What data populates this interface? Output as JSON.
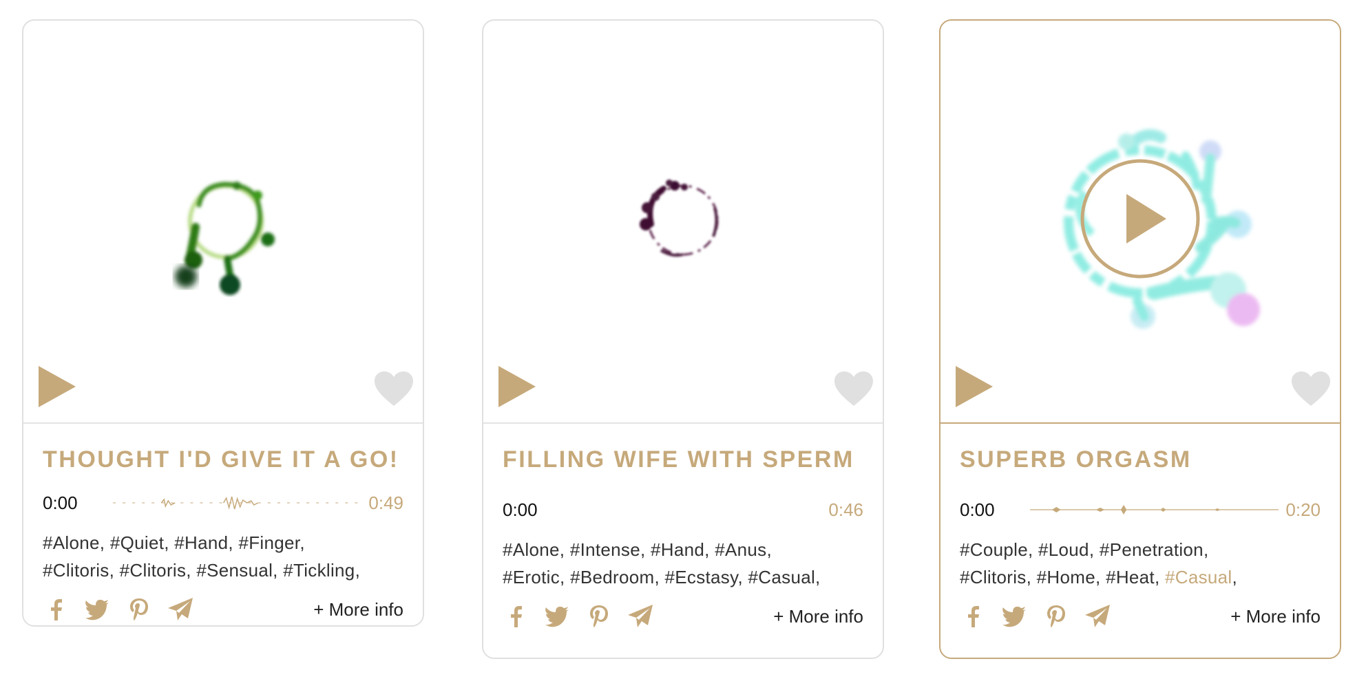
{
  "accent": "#c6a97b",
  "cards": [
    {
      "title": "THOUGHT I'D GIVE IT A GO!",
      "time_current": "0:00",
      "duration": "0:49",
      "tags": [
        "#Alone",
        "#Quiet",
        "#Hand",
        "#Finger",
        "#Clitoris",
        "#Clitoris",
        "#Sensual",
        "#Tickling"
      ],
      "highlighted_tag_index": -1,
      "visual_color": "#2f7d1c",
      "share_icons": [
        "facebook-icon",
        "twitter-icon",
        "pinterest-icon",
        "send-icon"
      ],
      "more_info": "+ More info"
    },
    {
      "title": "FILLING WIFE WITH SPERM",
      "time_current": "0:00",
      "duration": "0:46",
      "tags": [
        "#Alone",
        "#Intense",
        "#Hand",
        "#Anus",
        "#Erotic",
        "#Bedroom",
        "#Ecstasy",
        "#Casual"
      ],
      "highlighted_tag_index": -1,
      "visual_color": "#4a1a3c",
      "share_icons": [
        "facebook-icon",
        "twitter-icon",
        "pinterest-icon",
        "send-icon"
      ],
      "more_info": "+ More info"
    },
    {
      "title": "SUPERB ORGASM",
      "time_current": "0:00",
      "duration": "0:20",
      "tags": [
        "#Couple",
        "#Loud",
        "#Penetration",
        "#Clitoris",
        "#Home",
        "#Heat",
        "#Casual"
      ],
      "highlighted_tag_index": 6,
      "visual_color": "#7de9de",
      "share_icons": [
        "facebook-icon",
        "twitter-icon",
        "pinterest-icon",
        "send-icon"
      ],
      "more_info": "+ More info"
    }
  ]
}
